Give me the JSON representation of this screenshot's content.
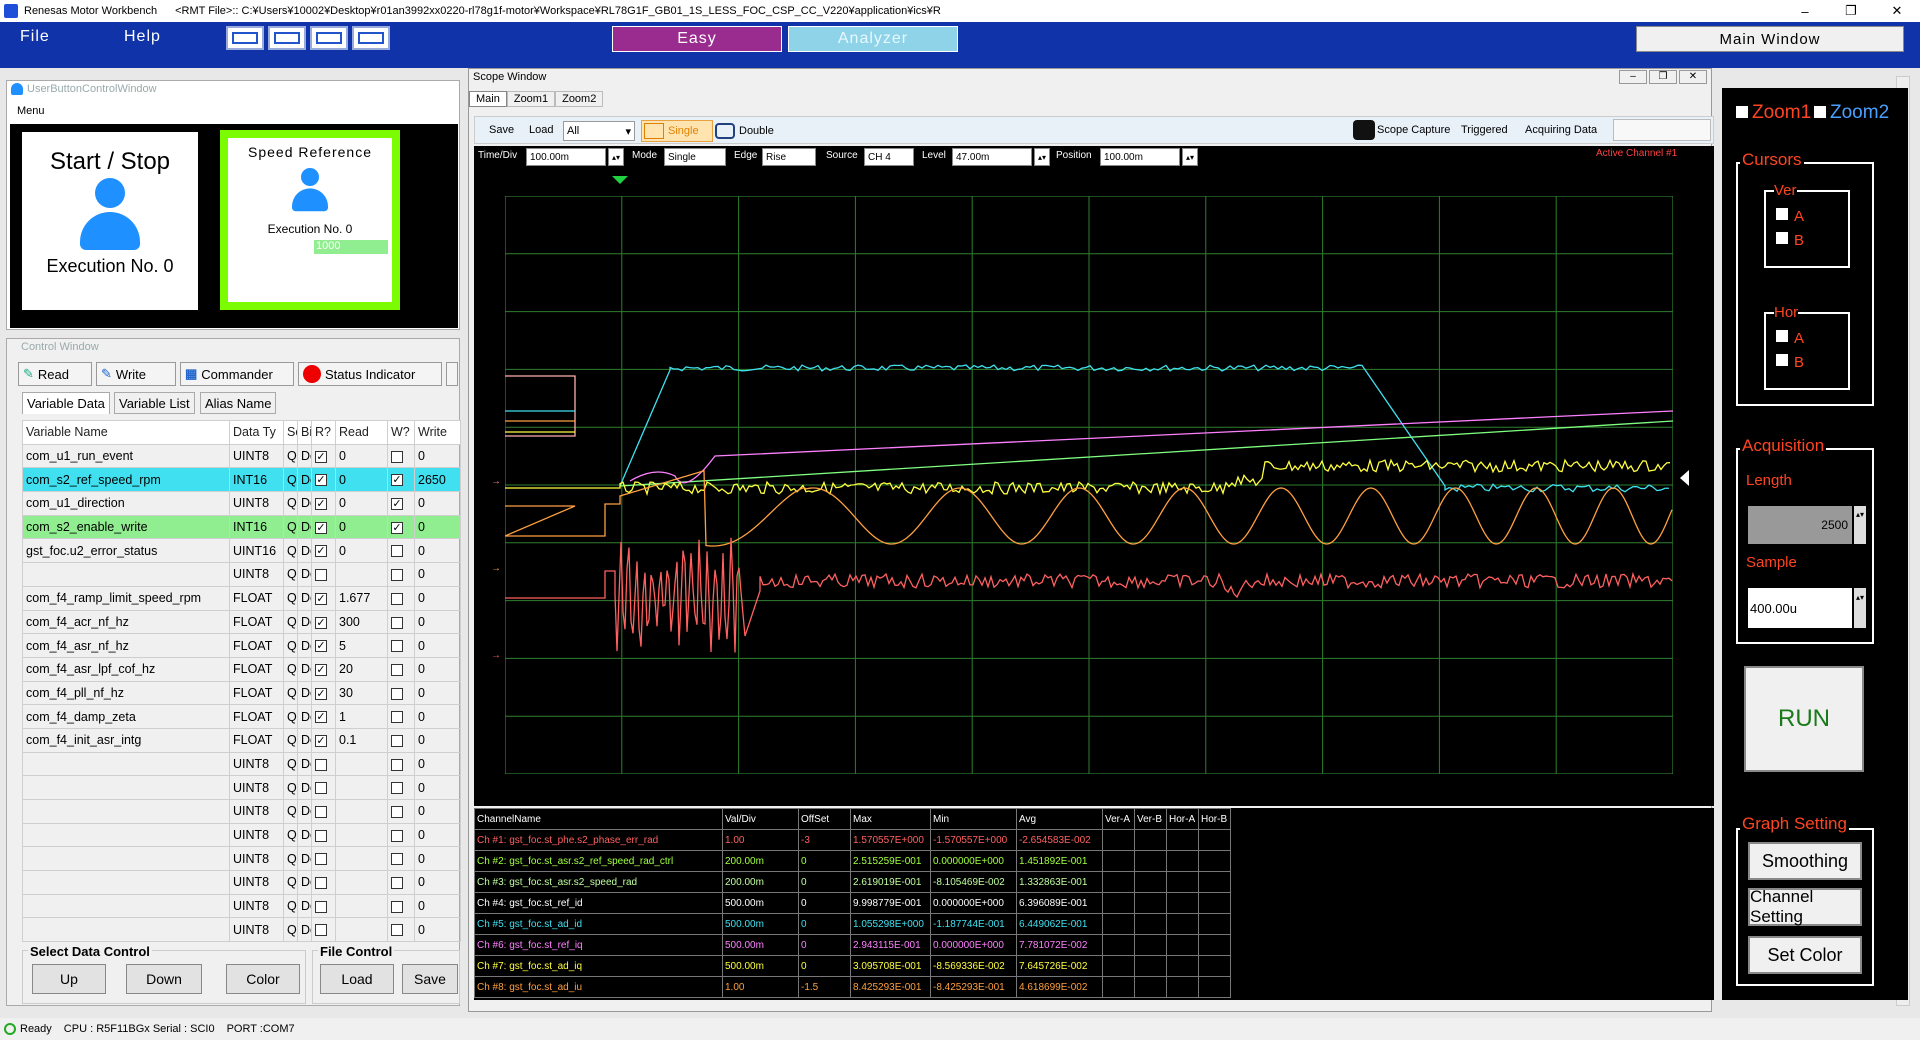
{
  "window": {
    "app": "Renesas Motor Workbench",
    "file": "<RMT File>:: C:¥Users¥10002¥Desktop¥r01an3992xx0220-rl78g1f-motor¥Workspace¥RL78G1F_GB01_1S_LESS_FOC_CSP_CC_V220¥application¥ics¥R",
    "controls": [
      "–",
      "❐",
      "✕"
    ]
  },
  "menu": {
    "file": "File",
    "help": "Help",
    "easy": "Easy",
    "analyzer": "Analyzer",
    "main_window": "Main Window"
  },
  "user_button_window": {
    "title": "UserButtonControlWindow",
    "menu": "Menu",
    "start_stop": {
      "label": "Start / Stop",
      "execution": "Execution No. 0"
    },
    "speed_ref": {
      "label": "Speed Reference",
      "execution": "Execution No. 0",
      "value": "1000"
    }
  },
  "control_window": {
    "title": "Control Window",
    "buttons": {
      "read": "Read",
      "write": "Write",
      "commander": "Commander",
      "status": "Status Indicator"
    },
    "tabs": [
      "Variable Data",
      "Variable List",
      "Alias Name"
    ],
    "columns": [
      "Variable Name",
      "Data Ty",
      "Sc",
      "Bi",
      "R?",
      "Read",
      "W?",
      "Write"
    ],
    "rows": [
      {
        "name": "com_u1_run_event",
        "type": "UINT8",
        "sc": "Q(",
        "bi": "De",
        "r": true,
        "read": "0",
        "w": false,
        "write": "0",
        "hl": ""
      },
      {
        "name": "com_s2_ref_speed_rpm",
        "type": "INT16",
        "sc": "Q(",
        "bi": "De",
        "r": true,
        "read": "0",
        "w": true,
        "write": "2650",
        "hl": "#40e0f0"
      },
      {
        "name": "com_u1_direction",
        "type": "UINT8",
        "sc": "Q(",
        "bi": "De",
        "r": true,
        "read": "0",
        "w": true,
        "write": "0",
        "hl": ""
      },
      {
        "name": "com_s2_enable_write",
        "type": "INT16",
        "sc": "Q(",
        "bi": "De",
        "r": true,
        "read": "0",
        "w": true,
        "write": "0",
        "hl": "#90ee90"
      },
      {
        "name": "gst_foc.u2_error_status",
        "type": "UINT16",
        "sc": "Q(",
        "bi": "De",
        "r": true,
        "read": "0",
        "w": false,
        "write": "0",
        "hl": ""
      },
      {
        "name": "",
        "type": "UINT8",
        "sc": "Q(",
        "bi": "De",
        "r": false,
        "read": "",
        "w": false,
        "write": "0",
        "hl": ""
      },
      {
        "name": "com_f4_ramp_limit_speed_rpm",
        "type": "FLOAT",
        "sc": "Q(",
        "bi": "De",
        "r": true,
        "read": "1.677",
        "w": false,
        "write": "0",
        "hl": ""
      },
      {
        "name": "com_f4_acr_nf_hz",
        "type": "FLOAT",
        "sc": "Q(",
        "bi": "De",
        "r": true,
        "read": "300",
        "w": false,
        "write": "0",
        "hl": ""
      },
      {
        "name": "com_f4_asr_nf_hz",
        "type": "FLOAT",
        "sc": "Q(",
        "bi": "De",
        "r": true,
        "read": "5",
        "w": false,
        "write": "0",
        "hl": ""
      },
      {
        "name": "com_f4_asr_lpf_cof_hz",
        "type": "FLOAT",
        "sc": "Q(",
        "bi": "De",
        "r": true,
        "read": "20",
        "w": false,
        "write": "0",
        "hl": ""
      },
      {
        "name": "com_f4_pll_nf_hz",
        "type": "FLOAT",
        "sc": "Q(",
        "bi": "De",
        "r": true,
        "read": "30",
        "w": false,
        "write": "0",
        "hl": ""
      },
      {
        "name": "com_f4_damp_zeta",
        "type": "FLOAT",
        "sc": "Q(",
        "bi": "De",
        "r": true,
        "read": "1",
        "w": false,
        "write": "0",
        "hl": ""
      },
      {
        "name": "com_f4_init_asr_intg",
        "type": "FLOAT",
        "sc": "Q(",
        "bi": "De",
        "r": true,
        "read": "0.1",
        "w": false,
        "write": "0",
        "hl": ""
      },
      {
        "name": "",
        "type": "UINT8",
        "sc": "Q(",
        "bi": "De",
        "r": false,
        "read": "",
        "w": false,
        "write": "0",
        "hl": ""
      },
      {
        "name": "",
        "type": "UINT8",
        "sc": "Q(",
        "bi": "De",
        "r": false,
        "read": "",
        "w": false,
        "write": "0",
        "hl": ""
      },
      {
        "name": "",
        "type": "UINT8",
        "sc": "Q(",
        "bi": "De",
        "r": false,
        "read": "",
        "w": false,
        "write": "0",
        "hl": ""
      },
      {
        "name": "",
        "type": "UINT8",
        "sc": "Q(",
        "bi": "De",
        "r": false,
        "read": "",
        "w": false,
        "write": "0",
        "hl": ""
      },
      {
        "name": "",
        "type": "UINT8",
        "sc": "Q(",
        "bi": "De",
        "r": false,
        "read": "",
        "w": false,
        "write": "0",
        "hl": ""
      },
      {
        "name": "",
        "type": "UINT8",
        "sc": "Q(",
        "bi": "De",
        "r": false,
        "read": "",
        "w": false,
        "write": "0",
        "hl": ""
      },
      {
        "name": "",
        "type": "UINT8",
        "sc": "Q(",
        "bi": "De",
        "r": false,
        "read": "",
        "w": false,
        "write": "0",
        "hl": ""
      },
      {
        "name": "",
        "type": "UINT8",
        "sc": "Q(",
        "bi": "De",
        "r": false,
        "read": "",
        "w": false,
        "write": "0",
        "hl": ""
      }
    ],
    "select_data_control": {
      "title": "Select Data Control",
      "up": "Up",
      "down": "Down",
      "color": "Color"
    },
    "file_control": {
      "title": "File Control",
      "load": "Load",
      "save": "Save"
    }
  },
  "scope": {
    "title": "Scope Window",
    "controls": [
      "–",
      "❐",
      "✕"
    ],
    "tabs": [
      "Main",
      "Zoom1",
      "Zoom2"
    ],
    "toolbar": {
      "save": "Save",
      "load": "Load",
      "load_sel": "All",
      "single": "Single",
      "double": "Double",
      "capture": "Scope Capture",
      "triggered": "Triggered",
      "acquiring": "Acquiring Data"
    },
    "params": {
      "time_div_lbl": "Time/Div",
      "time_div": "100.00m",
      "mode_lbl": "Mode",
      "mode": "Single",
      "edge_lbl": "Edge",
      "edge": "Rise",
      "source_lbl": "Source",
      "source": "CH 4",
      "level_lbl": "Level",
      "level": "47.00m",
      "position_lbl": "Position",
      "position": "100.00m",
      "active": "Active Channel #1"
    },
    "stat_headers": [
      "ChannelName",
      "Val/Div",
      "OffSet",
      "Max",
      "Min",
      "Avg",
      "Ver-A",
      "Ver-B",
      "Hor-A",
      "Hor-B"
    ],
    "channels": [
      {
        "name": "Ch #1: gst_foc.st_phe.s2_phase_err_rad",
        "div": "1.00",
        "off": "-3",
        "max": "1.570557E+000",
        "min": "-1.570557E+000",
        "avg": "-2.654583E-002",
        "color": "#ff6060"
      },
      {
        "name": "Ch #2: gst_foc.st_asr.s2_ref_speed_rad_ctrl",
        "div": "200.00m",
        "off": "0",
        "max": "2.515259E-001",
        "min": "0.000000E+000",
        "avg": "1.451892E-001",
        "color": "#a0ff40"
      },
      {
        "name": "Ch #3: gst_foc.st_asr.s2_speed_rad",
        "div": "200.00m",
        "off": "0",
        "max": "2.619019E-001",
        "min": "-8.105469E-002",
        "avg": "1.332863E-001",
        "color": "#c0ffa0"
      },
      {
        "name": "Ch #4: gst_foc.st_ref_id",
        "div": "500.00m",
        "off": "0",
        "max": "9.998779E-001",
        "min": "0.000000E+000",
        "avg": "6.396089E-001",
        "color": "#ffffff"
      },
      {
        "name": "Ch #5: gst_foc.st_ad_id",
        "div": "500.00m",
        "off": "0",
        "max": "1.055298E+000",
        "min": "-1.187744E-001",
        "avg": "6.449062E-001",
        "color": "#40e0f0"
      },
      {
        "name": "Ch #6: gst_foc.st_ref_iq",
        "div": "500.00m",
        "off": "0",
        "max": "2.943115E-001",
        "min": "0.000000E+000",
        "avg": "7.781072E-002",
        "color": "#ff80ff"
      },
      {
        "name": "Ch #7: gst_foc.st_ad_iq",
        "div": "500.00m",
        "off": "0",
        "max": "3.095708E-001",
        "min": "-8.569336E-002",
        "avg": "7.645726E-002",
        "color": "#ffff40"
      },
      {
        "name": "Ch #8: gst_foc.st_ad_iu",
        "div": "1.00",
        "off": "-1.5",
        "max": "8.425293E-001",
        "min": "-8.425293E-001",
        "avg": "4.618699E-002",
        "color": "#ffa040"
      }
    ]
  },
  "right_panel": {
    "zoom1": "Zoom1",
    "zoom2": "Zoom2",
    "cursors": "Cursors",
    "ver": "Ver",
    "hor": "Hor",
    "a": "A",
    "b": "B",
    "acquisition": "Acquisition",
    "length_lbl": "Length",
    "length": "2500",
    "sample_lbl": "Sample",
    "sample": "400.00u",
    "run": "RUN",
    "graph_setting": "Graph Setting",
    "smoothing": "Smoothing",
    "channel_setting": "Channel Setting",
    "set_color": "Set Color"
  },
  "status": {
    "ready": "Ready",
    "cpu": "CPU : R5F11BGx Serial : SCI0",
    "port": "PORT :COM7"
  }
}
